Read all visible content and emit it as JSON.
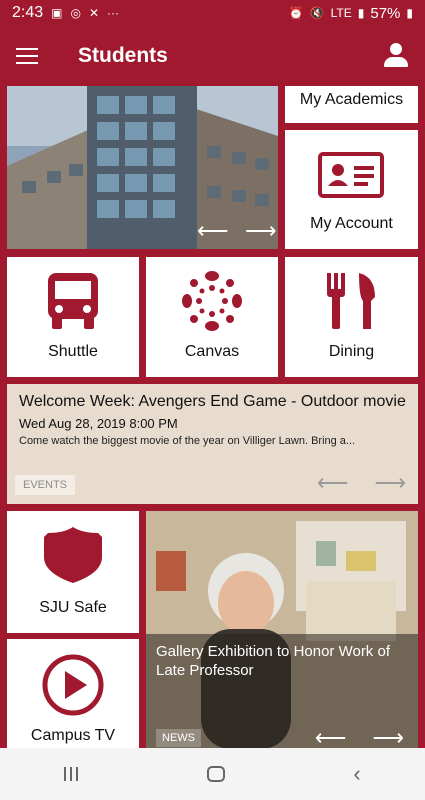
{
  "status_bar": {
    "time": "2:43",
    "battery": "57%",
    "network": "LTE"
  },
  "app_bar": {
    "title": "Students"
  },
  "tiles": {
    "my_academics": "My Academics",
    "my_account": "My Account",
    "shuttle": "Shuttle",
    "canvas": "Canvas",
    "dining": "Dining",
    "sju_safe": "SJU Safe",
    "campus_tv": "Campus TV"
  },
  "event": {
    "title": "Welcome Week: Avengers End Game - Outdoor movie",
    "date": "Wed Aug 28, 2019 8:00 PM",
    "description": "Come watch the biggest movie of the year on Villiger Lawn. Bring a...",
    "tag": "EVENTS"
  },
  "news": {
    "title": "Gallery Exhibition to Honor Work of Late Professor",
    "tag": "NEWS"
  },
  "colors": {
    "brand": "#a0192f",
    "event_bg": "#e7dccd"
  }
}
